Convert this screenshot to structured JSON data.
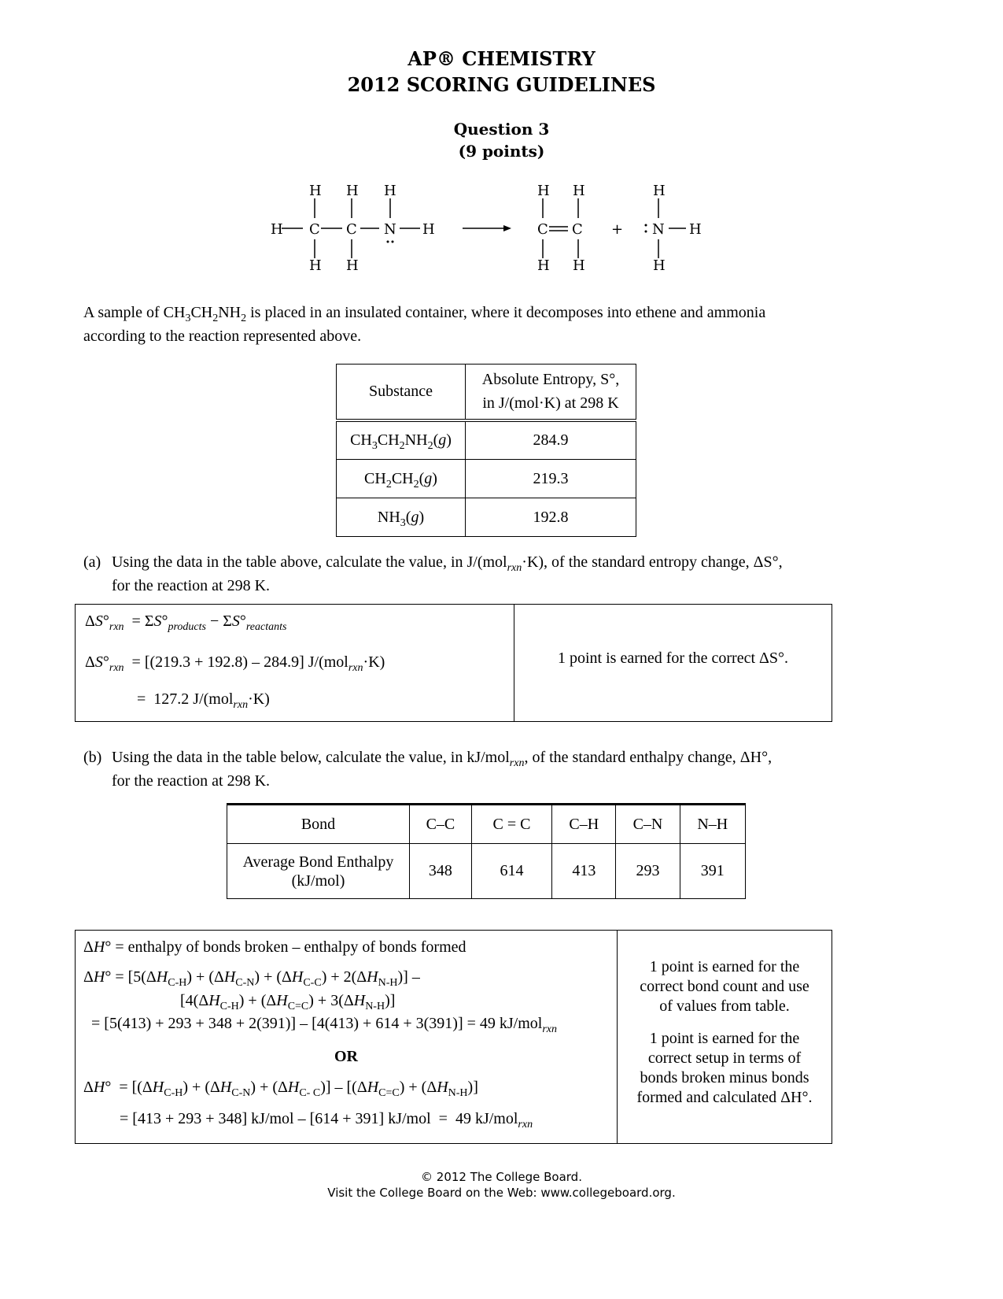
{
  "header": {
    "title_line1": "AP® CHEMISTRY",
    "title_line2": "2012 SCORING GUIDELINES",
    "question": "Question 3",
    "points": "(9 points)"
  },
  "reaction_diagram": {
    "reactant": "CH3CH2NH2 (ethylamine) Lewis structure",
    "products": [
      "C2H4 (ethene) Lewis structure",
      "NH3 (ammonia) Lewis structure"
    ],
    "plus": "+",
    "arrow": "→"
  },
  "intro": {
    "line1_a": "A sample of CH",
    "line1_b": "CH",
    "line1_c": "NH",
    "line1_d": " is placed in an insulated container, where it decomposes into ethene and ammonia",
    "line2": "according to the reaction represented above."
  },
  "entropy_table": {
    "header_substance": "Substance",
    "header_entropy_line1": "Absolute Entropy, S°,",
    "header_entropy_line2": "in J/(mol·K) at 298 K",
    "rows": [
      {
        "substance": "CH3CH2NH2(g)",
        "value": "284.9"
      },
      {
        "substance": "CH2CH2(g)",
        "value": "219.3"
      },
      {
        "substance": "NH3(g)",
        "value": "192.8"
      }
    ]
  },
  "part_a": {
    "label": "(a)",
    "question_line1_a": "Using the data in the table above, calculate the value, in J/(mol",
    "question_line1_sub": "rxn",
    "question_line1_b": "·K), of the standard entropy change, ΔS°,",
    "question_line2": "for the reaction at 298 K.",
    "eq1": "ΔS°rxn = ΣS°products − ΣS°reactants",
    "eq2": "ΔS°rxn = [(219.3 + 192.8) – 284.9] J/(molrxn·K)",
    "eq3": "= 127.2 J/(molrxn·K)",
    "point": "1 point is earned for the correct ΔS°."
  },
  "part_b": {
    "label": "(b)",
    "question_line1_a": "Using the data in the table below, calculate the value, in kJ/mol",
    "question_line1_sub": "rxn",
    "question_line1_b": ", of the standard enthalpy change, ΔH°,",
    "question_line2": "for the reaction at 298 K."
  },
  "bond_table": {
    "header_label": "Bond",
    "row_label_line1": "Average Bond Enthalpy",
    "row_label_line2": "(kJ/mol)",
    "bonds": [
      "C–C",
      "C = C",
      "C–H",
      "C–N",
      "N–H"
    ],
    "values": [
      "348",
      "614",
      "413",
      "293",
      "391"
    ]
  },
  "part_b_solution": {
    "eq1": "ΔH° = enthalpy of bonds broken – enthalpy of bonds formed",
    "eq2": "ΔH° = [5(ΔHC-H) + (ΔHC-N) + (ΔHC-C) + 2(ΔHN-H)] –",
    "eq3": "[4(ΔHC-H) + (ΔHC=C) + 3(ΔHN-H)]",
    "eq4": "= [5(413) + 293 + 348 + 2(391)] – [4(413) + 614 + 3(391)] = 49 kJ/molrxn",
    "or": "OR",
    "eq5": "ΔH° = [(ΔHC-H) + (ΔHC-N) + (ΔHC-C)] – [(ΔHC=C) + (ΔHN-H)]",
    "eq6": "= [413 + 293 + 348] kJ/mol – [614 + 391] kJ/mol = 49 kJ/molrxn",
    "point1_line1": "1 point is earned for the",
    "point1_line2": "correct bond count and use",
    "point1_line3": "of values from table.",
    "point2_line1": "1 point is earned for the",
    "point2_line2": "correct setup in terms of",
    "point2_line3": "bonds broken minus bonds",
    "point2_line4": "formed and calculated ΔH°."
  },
  "footer": {
    "copyright": "© 2012 The College Board.",
    "visit": "Visit the College Board on the Web: www.collegeboard.org."
  }
}
